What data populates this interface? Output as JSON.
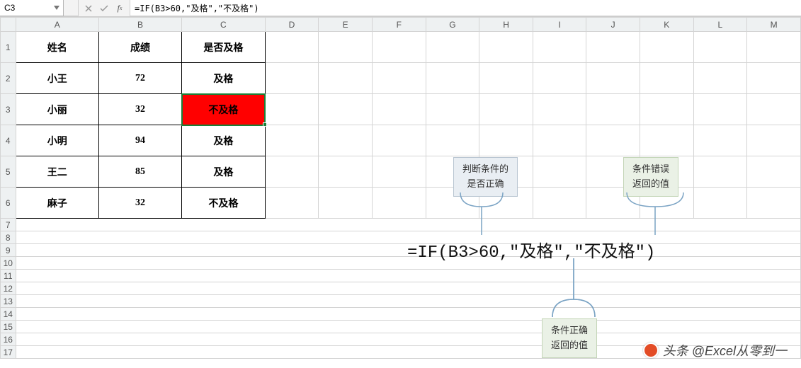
{
  "namebox": {
    "value": "C3"
  },
  "formula_bar": {
    "value": "=IF(B3>60,\"及格\",\"不及格\")"
  },
  "columns": [
    "A",
    "B",
    "C",
    "D",
    "E",
    "F",
    "G",
    "H",
    "I",
    "J",
    "K",
    "L",
    "M"
  ],
  "rows": [
    "1",
    "2",
    "3",
    "4",
    "5",
    "6",
    "7",
    "8",
    "9",
    "10",
    "11",
    "12",
    "13",
    "14",
    "15",
    "16",
    "17"
  ],
  "table": {
    "header": {
      "a": "姓名",
      "b": "成绩",
      "c": "是否及格"
    },
    "rows": [
      {
        "a": "小王",
        "b": "72",
        "c": "及格"
      },
      {
        "a": "小丽",
        "b": "32",
        "c": "不及格"
      },
      {
        "a": "小明",
        "b": "94",
        "c": "及格"
      },
      {
        "a": "王二",
        "b": "85",
        "c": "及格"
      },
      {
        "a": "麻子",
        "b": "32",
        "c": "不及格"
      }
    ],
    "active": {
      "row": 3,
      "col": "C"
    },
    "highlight_cell": {
      "row": 3,
      "col": "C"
    }
  },
  "annotations": {
    "condition": {
      "line1": "判断条件的",
      "line2": "是否正确"
    },
    "true_return": {
      "line1": "条件正确",
      "line2": "返回的值"
    },
    "false_return": {
      "line1": "条件错误",
      "line2": "返回的值"
    }
  },
  "big_formula": "=IF(B3>60,\"及格\",\"不及格\")",
  "watermark": "头条 @Excel从零到一"
}
